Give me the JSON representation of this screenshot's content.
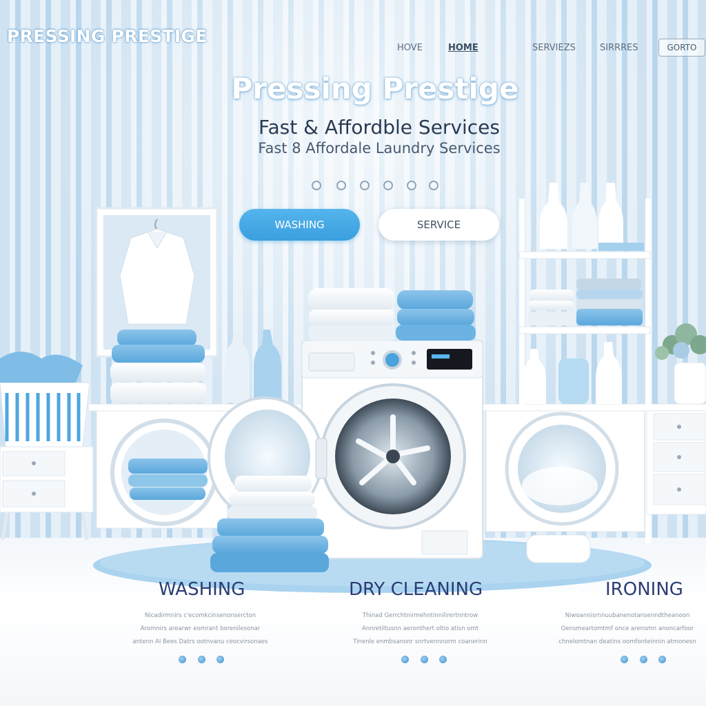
{
  "brand": {
    "name": "PRESSING PRESTIGE"
  },
  "nav": {
    "items": [
      {
        "label": "HOVE"
      },
      {
        "label": "HOME"
      },
      {
        "label": "SERVIEZS"
      },
      {
        "label": "SIRRRES"
      }
    ],
    "cta_label": "GORTO"
  },
  "hero": {
    "title": "Pressing Prestige",
    "subtitle": "Fast & Affordble  Services",
    "subtitle2": "Fast 8  Affordale Laundry Services"
  },
  "buttons": {
    "primary": "WASHING",
    "secondary": "SERVICE"
  },
  "services": [
    {
      "title": "WASHING",
      "description": [
        "Nicadirmnirs c'ecomkcinsenonsercton",
        "Aromnirs arearwr eomrant borenilesonar",
        "antenn AI Bees Datrs ootnvanu ceocvirsonaes"
      ]
    },
    {
      "title": "DRY CLEANING",
      "description": [
        "Thinad Gerrchtnirmehntinnilirertnntrow",
        "Annretiltusnn aeronthert oltio atisn omt",
        "Tinenle enmbsanonr snrtvennnorm coanerinn"
      ]
    },
    {
      "title": "IRONING",
      "description": [
        "Niwoannisrnnuubanenotansenndtheanoon",
        "Oensmeartomtmf once arensmn anoncarfoor",
        "chnelomtnan deatins oomfonteinnin atmonesn"
      ]
    }
  ],
  "colors": {
    "accent": "#3a9fdf",
    "wall_light": "#e9f2fa",
    "wall_stripe": "#b9d6ec",
    "heading_dark": "#2b3d73"
  },
  "icons": [
    "social-icon",
    "social-icon",
    "social-icon",
    "social-icon",
    "social-icon",
    "social-icon"
  ]
}
